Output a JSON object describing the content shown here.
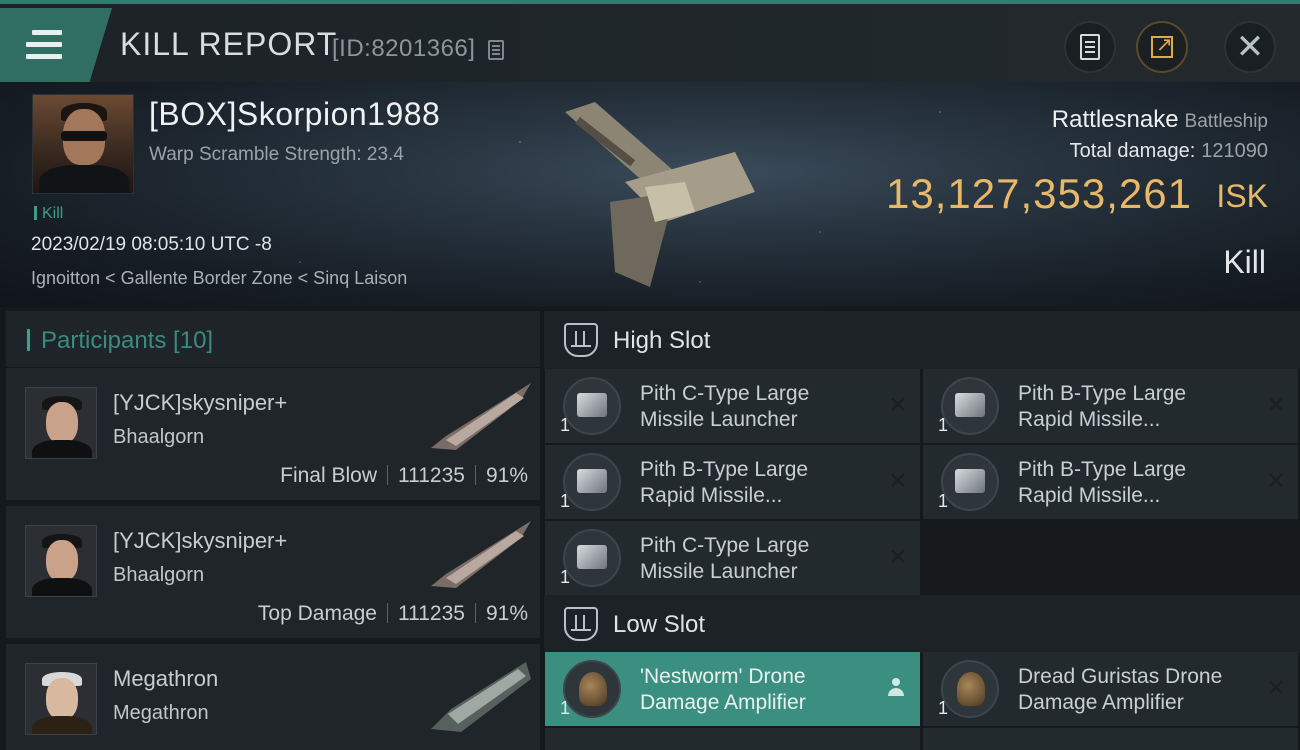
{
  "header": {
    "title": "KILL REPORT",
    "report_id": "[ID:8201366]"
  },
  "victim": {
    "name": "[BOX]Skorpion1988",
    "warp_scramble": "Warp Scramble Strength: 23.4",
    "kill_tag": "Kill",
    "timestamp": "2023/02/19 08:05:10 UTC -8",
    "location": "Ignoitton < Gallente Border Zone < Sinq Laison"
  },
  "ship": {
    "name": "Rattlesnake",
    "class": "Battleship",
    "total_damage_label": "Total damage:",
    "total_damage_value": "121090",
    "isk_value": "13,127,353,261",
    "isk_unit": "ISK",
    "result": "Kill"
  },
  "participants": {
    "title": "Participants [10]",
    "rows": [
      {
        "name": "[YJCK]skysniper+",
        "ship": "Bhaalgorn",
        "role": "Final Blow",
        "damage": "111235",
        "percent": "91%"
      },
      {
        "name": "[YJCK]skysniper+",
        "ship": "Bhaalgorn",
        "role": "Top Damage",
        "damage": "111235",
        "percent": "91%"
      },
      {
        "name": "Megathron",
        "ship": "Megathron",
        "role": "",
        "damage": "",
        "percent": ""
      }
    ]
  },
  "fittings": {
    "high_slot": {
      "title": "High Slot",
      "modules": [
        {
          "qty": "1",
          "name_line1": "Pith C-Type Large",
          "name_line2": "Missile Launcher"
        },
        {
          "qty": "1",
          "name_line1": "Pith B-Type Large",
          "name_line2": "Rapid Missile..."
        },
        {
          "qty": "1",
          "name_line1": "Pith B-Type Large",
          "name_line2": "Rapid Missile..."
        },
        {
          "qty": "1",
          "name_line1": "Pith B-Type Large",
          "name_line2": "Rapid Missile..."
        },
        {
          "qty": "1",
          "name_line1": "Pith C-Type Large",
          "name_line2": "Missile Launcher"
        }
      ]
    },
    "low_slot": {
      "title": "Low Slot",
      "modules": [
        {
          "qty": "1",
          "name_line1": "'Nestworm' Drone",
          "name_line2": "Damage Amplifier"
        },
        {
          "qty": "1",
          "name_line1": "Dread Guristas Drone",
          "name_line2": " Damage Amplifier"
        }
      ]
    },
    "dismiss_glyph": "✕"
  },
  "colors": {
    "accent": "#2d7f6e",
    "isk": "#e7b867",
    "highlight_row": "#3b8f80"
  }
}
